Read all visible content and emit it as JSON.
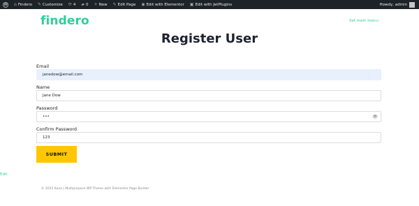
{
  "adminbar": {
    "site_name": "Findero",
    "customize": "Customize",
    "updates_count": "4",
    "comments_count": "0",
    "new_label": "New",
    "edit_page": "Edit Page",
    "edit_elementor": "Edit with Elementor",
    "edit_jet": "Edit with JetPlugins",
    "howdy": "Howdy, admin"
  },
  "header": {
    "logo": "findero",
    "menu_link": "Set main menu"
  },
  "page": {
    "title": "Register User"
  },
  "form": {
    "email": {
      "label": "Email",
      "value": "janedow@email.com"
    },
    "name": {
      "label": "Name",
      "value": "Jane Dow"
    },
    "password": {
      "label": "Password",
      "value": "•••"
    },
    "confirm": {
      "label": "Confirm Password",
      "value": "123"
    },
    "submit_label": "SUBMIT"
  },
  "edit_link": "Edit",
  "footer": {
    "text": "© 2025 Kava | Multipurpose WP Theme with Elementor Page Builder"
  },
  "colors": {
    "accent": "#2fcf9a",
    "button": "#ffc700",
    "adminbar": "#1d2327",
    "autofill": "#e8f0fe"
  }
}
